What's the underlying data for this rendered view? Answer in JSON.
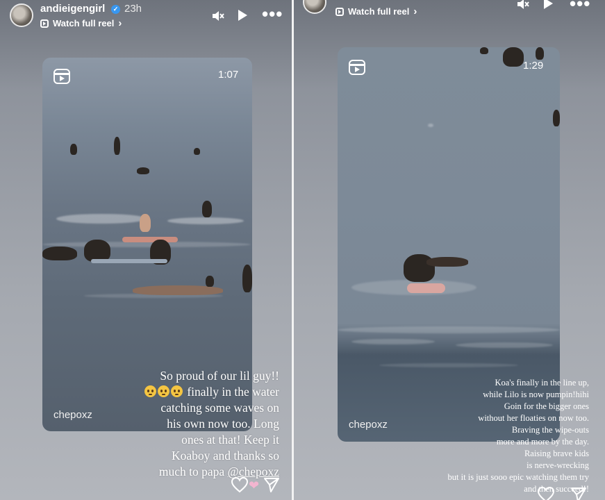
{
  "left_story": {
    "username": "andieigengirl",
    "time": "23h",
    "watch_full_reel": "Watch full reel",
    "duration": "1:07",
    "credit": "chepoxz",
    "caption_lines": [
      "So proud of our lil guy!!",
      " finally in the water",
      "catching some waves on",
      "his own now too. Long",
      "ones at that! Keep it",
      "Koaboy and thanks so",
      "much to papa "
    ],
    "mention": "@chepoxz"
  },
  "right_story": {
    "watch_full_reel": "Watch full reel",
    "duration": "1:29",
    "credit": "chepoxz",
    "caption_lines": [
      "Koa's finally in the line up,",
      "while Lilo is now pumpin!hihi",
      "Goin for the bigger ones",
      "without her floaties on now too.",
      "Braving the wipe-outs",
      "more and more by the day.",
      "Raising brave kids",
      "is nerve-wrecking",
      "but it is just sooo epic watching them try",
      "and then succeed!!"
    ]
  },
  "icons": {
    "mute": "speaker-muted-icon",
    "play": "play-icon",
    "more": "more-dots-icon",
    "reel": "reel-icon",
    "like": "heart-icon",
    "share": "send-icon"
  },
  "colors": {
    "verified": "#3897f0",
    "sticker": "#f3b5d0"
  }
}
